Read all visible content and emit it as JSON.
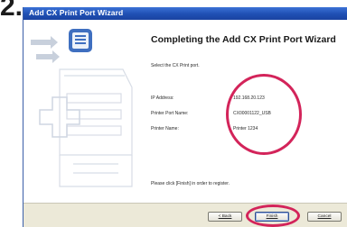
{
  "step_number": "2.",
  "window": {
    "title": "Add CX Print Port Wizard"
  },
  "content": {
    "heading": "Completing the Add CX Print Port Wizard",
    "instruction": "Select the CX Print port.",
    "fields": [
      {
        "label": "IP Address:",
        "value": "192.168.20.123"
      },
      {
        "label": "Printer Port Name:",
        "value": "CX00001122_USB"
      },
      {
        "label": "Printer Name:",
        "value": "Printer 1234"
      }
    ],
    "footer_note": "Please click [Finish] in order to register."
  },
  "buttons": {
    "back": "< Back",
    "finish": "Finish",
    "cancel": "Cancel"
  },
  "colors": {
    "titlebar": "#1f4fb3",
    "highlight_ellipse": "#d3245a"
  }
}
